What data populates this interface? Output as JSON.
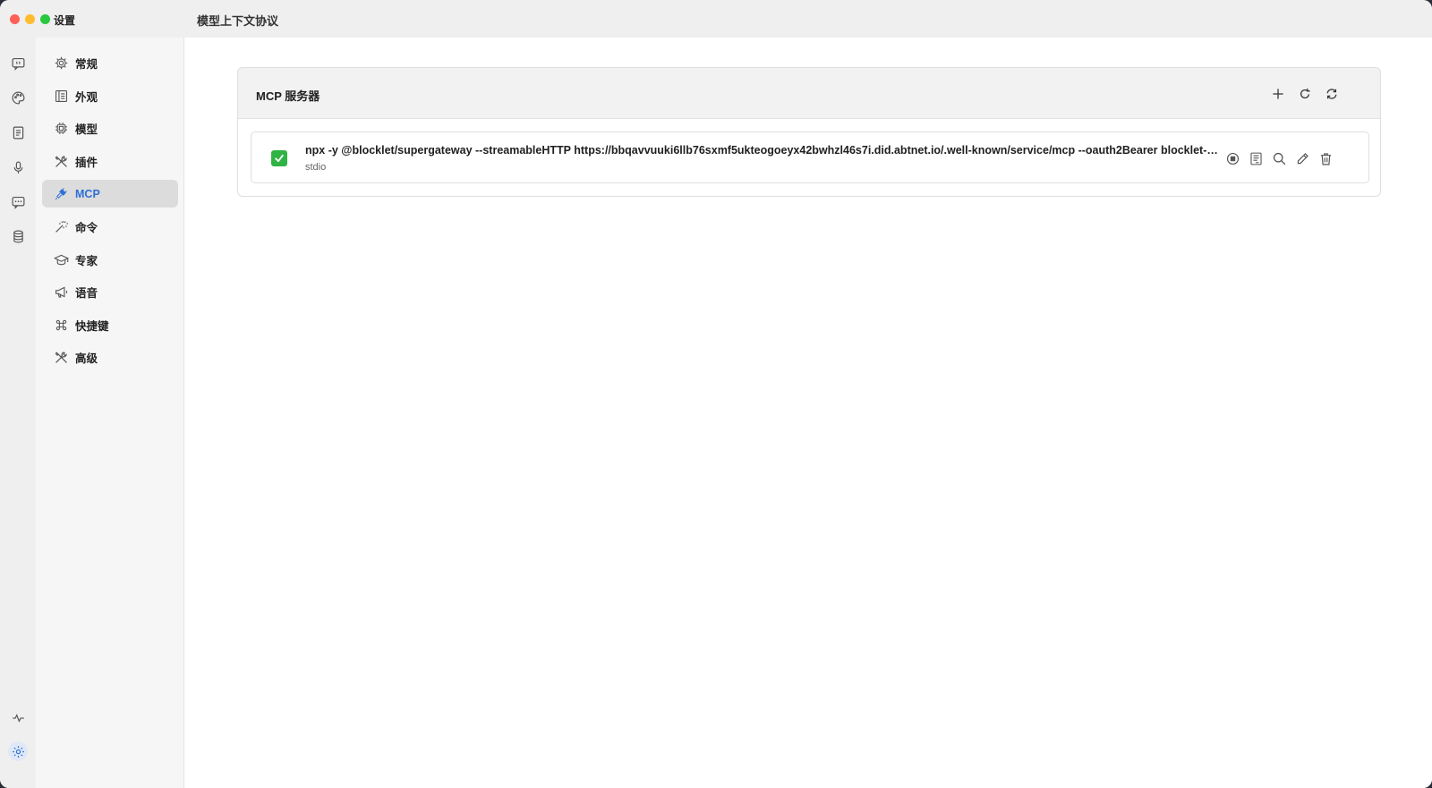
{
  "window": {
    "app_title": "设置",
    "page_title": "模型上下文协议"
  },
  "rail": {
    "items": [
      {
        "icon": "chat-quote-icon"
      },
      {
        "icon": "palette-icon"
      },
      {
        "icon": "document-icon"
      },
      {
        "icon": "microphone-icon"
      },
      {
        "icon": "message-icon"
      },
      {
        "icon": "database-icon"
      },
      {
        "icon": "activity-icon"
      },
      {
        "icon": "gear-icon"
      }
    ]
  },
  "sidebar": {
    "items": [
      {
        "label": "常规",
        "icon": "gear-icon"
      },
      {
        "label": "外观",
        "icon": "layout-icon"
      },
      {
        "label": "模型",
        "icon": "chip-icon"
      },
      {
        "label": "插件",
        "icon": "tools-icon"
      },
      {
        "label": "MCP",
        "icon": "plug-icon",
        "active": true
      },
      {
        "label": "命令",
        "icon": "magic-wand-icon"
      },
      {
        "label": "专家",
        "icon": "graduation-cap-icon"
      },
      {
        "label": "语音",
        "icon": "megaphone-icon"
      },
      {
        "label": "快捷键",
        "icon": "command-key-icon"
      },
      {
        "label": "高级",
        "icon": "tools-icon"
      }
    ]
  },
  "mcp_panel": {
    "title": "MCP 服务器",
    "servers": [
      {
        "command": "npx -y @blocklet/supergateway --streamableHTTP https://bbqavvuuki6llb76sxmf5ukteogoeyx42bwhzl46s7i.did.abtnet.io/.well-known/service/mcp --oauth2Bearer blocklet-z...",
        "type": "stdio",
        "status": "enabled"
      }
    ]
  },
  "colors": {
    "accent": "#2f6fd6",
    "status_ok": "#2fb344"
  }
}
